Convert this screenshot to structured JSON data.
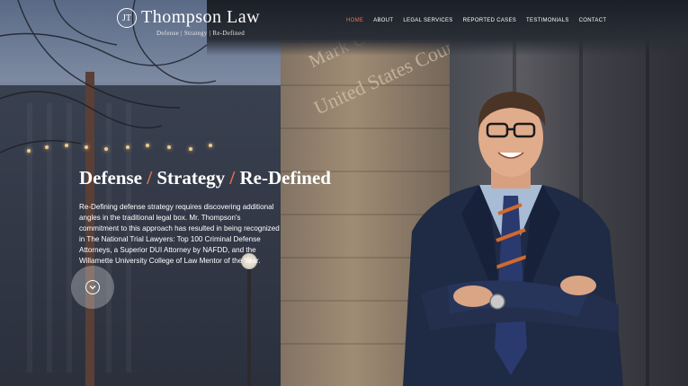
{
  "brand": {
    "monogram": "JT",
    "name": "Thompson Law",
    "tagline": "Defense | Strategy | Re-Defined"
  },
  "nav": {
    "items": [
      {
        "label": "HOME",
        "active": true
      },
      {
        "label": "ABOUT",
        "active": false
      },
      {
        "label": "LEGAL SERVICES",
        "active": false
      },
      {
        "label": "REPORTED CASES",
        "active": false
      },
      {
        "label": "TESTIMONIALS",
        "active": false
      },
      {
        "label": "CONTACT",
        "active": false
      }
    ]
  },
  "hero": {
    "headline": {
      "word1": "Defense",
      "word2": "Strategy",
      "word3": "Re-Defined",
      "separator": "/"
    },
    "body": "Re-Defining defense strategy requires discovering additional angles in the traditional legal box. Mr. Thompson's commitment to this approach has resulted in being recognized in The National Trial Lawyers: Top 100 Criminal Defense Attorneys, a Superior DUI Attorney by NAFDD, and the Willamette University College of Law Mentor of the Year.",
    "scroll_icon": "chevron-down-icon"
  },
  "background_sign": {
    "line1": "Mark O. Hatfield",
    "line2": "United States Courthouse"
  },
  "colors": {
    "accent": "#e8744f",
    "text": "#ffffff"
  }
}
